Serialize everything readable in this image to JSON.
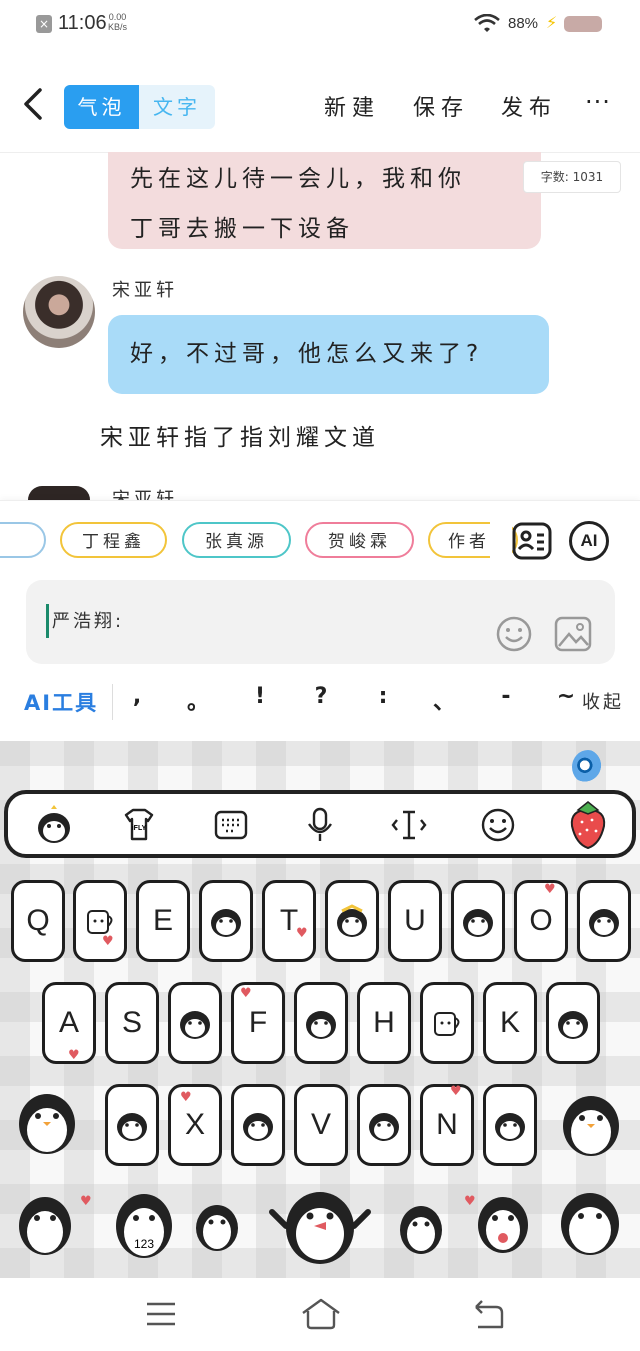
{
  "status_bar": {
    "time": "11:06",
    "net_speed_value": "0.00",
    "net_speed_unit": "KB/s",
    "battery_percent": "88%"
  },
  "header": {
    "mode_bubble": "气泡",
    "mode_text": "文字",
    "new_label": "新建",
    "save_label": "保存",
    "publish_label": "发布",
    "more_label": "···"
  },
  "chat": {
    "prev_bubble_lines": [
      "先在这儿待一会儿，我和你",
      "丁哥去搬一下设备"
    ],
    "word_count": "字数: 1031",
    "message": {
      "sender": "宋亚轩",
      "text": "好，不过哥，他怎么又来了?"
    },
    "narration": "宋亚轩指了指刘耀文道",
    "next_sender": "宋亚轩"
  },
  "character_chips": [
    {
      "label": "丁程鑫",
      "color": "#f2c43a"
    },
    {
      "label": "张真源",
      "color": "#4ec6c8"
    },
    {
      "label": "贺峻霖",
      "color": "#ef7d9a"
    },
    {
      "label": "作者",
      "color": "#f2c43a"
    }
  ],
  "input": {
    "value": "严浩翔:"
  },
  "tools": {
    "ai_tools_label": "AI工具",
    "punctuation": [
      ",",
      "。",
      "!",
      "?",
      ":",
      "、",
      "-",
      "~"
    ],
    "collapse_label": "收起",
    "ai_button_label": "AI"
  },
  "keyboard": {
    "toolbar_icons": [
      "penguin-icon",
      "ifly-shirt-icon",
      "keyboard-icon",
      "mic-icon",
      "text-cursor-icon",
      "smile-icon",
      "strawberry-icon"
    ],
    "shirt_label": "iFLY",
    "row1": [
      "Q",
      "",
      "E",
      "",
      "T",
      "",
      "U",
      "",
      "O",
      ""
    ],
    "row2": [
      "A",
      "S",
      "",
      "F",
      "",
      "H",
      "",
      "K",
      ""
    ],
    "row3": [
      "",
      "X",
      "",
      "V",
      "",
      "N",
      ""
    ],
    "num_key_label": "123"
  },
  "colors": {
    "accent_blue": "#2a9ef0",
    "bubble_blue": "#a9dbf8",
    "bubble_pink": "#f3dcdd",
    "ai_tools_blue": "#2a7ee0",
    "cursor_green": "#1b8a6b"
  }
}
